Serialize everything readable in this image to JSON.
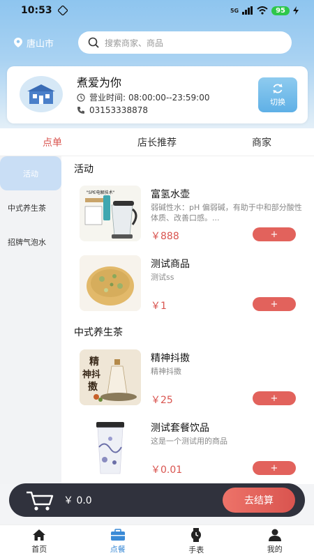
{
  "status": {
    "time": "10:53",
    "battery": "95",
    "network": "5G"
  },
  "header": {
    "city": "唐山市",
    "search_placeholder": "搜索商家、商品"
  },
  "store": {
    "name": "煮爱为你",
    "hours_label": "营业时间:",
    "hours": "08:00:00--23:59:00",
    "phone": "03153338878",
    "switch_label": "切换"
  },
  "tabs": [
    {
      "label": "点单",
      "active": true
    },
    {
      "label": "店长推荐",
      "active": false
    },
    {
      "label": "商家",
      "active": false
    }
  ],
  "sidebar": {
    "items": [
      {
        "label": "活动",
        "active": true
      },
      {
        "label": "中式养生茶",
        "active": false
      },
      {
        "label": "招牌气泡水",
        "active": false
      }
    ]
  },
  "sections": [
    {
      "title": "活动",
      "products": [
        {
          "name": "富氢水壶",
          "desc": "弱碱性水：pH 偏弱碱，有助于中和部分酸性体质、改善口感。...",
          "price": "￥888",
          "add": "+",
          "image_text": "\"SPE电解技术\""
        },
        {
          "name": "测试商品",
          "desc": "测试ss",
          "price": "￥1",
          "add": "+"
        }
      ]
    },
    {
      "title": "中式养生茶",
      "products": [
        {
          "name": "精神抖擞",
          "desc": "精神抖擞",
          "price": "￥25",
          "add": "+"
        },
        {
          "name": "测试套餐饮品",
          "desc": "这是一个测试用的商品",
          "price": "￥0.01",
          "add": "+"
        }
      ]
    }
  ],
  "cart": {
    "total": "￥ 0.0",
    "checkout_label": "去结算"
  },
  "bottom_nav": [
    {
      "label": "首页",
      "icon": "home-icon",
      "active": false
    },
    {
      "label": "点餐",
      "icon": "briefcase-icon",
      "active": true
    },
    {
      "label": "手表",
      "icon": "watch-icon",
      "active": false
    },
    {
      "label": "我的",
      "icon": "user-icon",
      "active": false
    }
  ],
  "colors": {
    "accent": "#d9544f",
    "nav_active": "#3a8ad6",
    "cart_bar": "#30323d"
  }
}
